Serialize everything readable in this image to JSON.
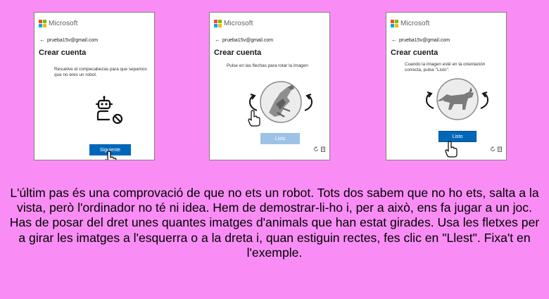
{
  "colors": {
    "background": "#f98df5",
    "button_primary": "#0067b8",
    "button_disabled": "#9cc3e6",
    "logo": [
      "#f25022",
      "#7fba00",
      "#00a4ef",
      "#ffb900"
    ]
  },
  "panels": [
    {
      "logo_text": "Microsoft",
      "email": "prueba15v@gmail.com",
      "title": "Crear cuenta",
      "instruction": "Resuelve el rompecabezas para que sepamos que no eres un robot.",
      "button_label": "Siguiente",
      "icons": [
        "back-arrow-icon",
        "robot-icon",
        "no-entry-icon",
        "hand-cursor-icon"
      ]
    },
    {
      "logo_text": "Microsoft",
      "email": "prueba15v@gmail.com",
      "title": "Crear cuenta",
      "instruction": "Pulse en las flechas para rotar la imagen",
      "button_label": "Listo",
      "icons": [
        "back-arrow-icon",
        "rotate-left-icon",
        "rotate-right-icon",
        "hand-cursor-icon",
        "refresh-icon",
        "audio-icon"
      ]
    },
    {
      "logo_text": "Microsoft",
      "email": "prueba15v@gmail.com",
      "title": "Crear cuenta",
      "instruction": "Cuando la imagen esté en la orientación correcta, pulse \"Listo\".",
      "button_label": "Listo",
      "icons": [
        "back-arrow-icon",
        "rotate-left-icon",
        "rotate-right-icon",
        "hand-cursor-icon",
        "refresh-icon",
        "audio-icon"
      ]
    }
  ],
  "caption": "L'últim pas és una comprovació de que no ets un robot. Tots dos sabem que no ho ets, salta a la vista, però l'ordinador no té ni idea. Hem de demostrar-li-ho i, per a això, ens fa jugar a un joc. Has de posar del dret unes quantes imatges d'animals que han estat girades. Usa les fletxes per a girar les imatges a l'esquerra o a la dreta i, quan estiguin rectes, fes clic en \"Llest\". Fixa't en l'exemple."
}
